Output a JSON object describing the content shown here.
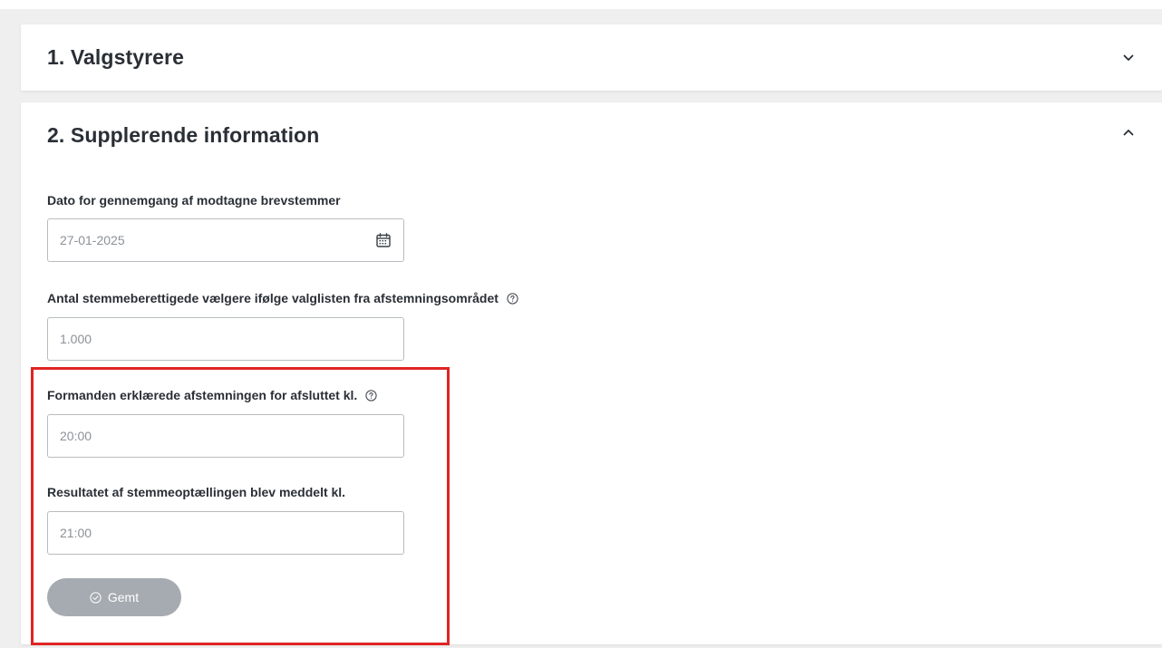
{
  "sections": [
    {
      "title": "1. Valgstyrere",
      "expanded": false,
      "toggle_icon": "chevron-down-icon"
    },
    {
      "title": "2. Supplerende information",
      "expanded": true,
      "toggle_icon": "chevron-up-icon",
      "fields": {
        "date_review": {
          "label": "Dato for gennemgang af modtagne brevstemmer",
          "value": "27-01-2025",
          "icon": "calendar-icon"
        },
        "eligible_voters": {
          "label": "Antal stemmeberettigede vælgere ifølge valglisten fra afstemningsområdet",
          "value": "1.000",
          "icon": "help-icon"
        },
        "closing_time": {
          "label": "Formanden erklærede afstemningen for afsluttet kl.",
          "value": "20:00",
          "icon": "help-icon"
        },
        "result_time": {
          "label": "Resultatet af stemmeoptællingen blev meddelt kl.",
          "value": "21:00"
        }
      },
      "save_button": {
        "label": "Gemt",
        "icon": "check-circle-icon"
      }
    }
  ],
  "colors": {
    "highlight": "#e02424",
    "saved_button_bg": "#a6abb1",
    "text": "#2a2f36",
    "input_text": "#8c9197",
    "border": "#b9bcc0"
  }
}
